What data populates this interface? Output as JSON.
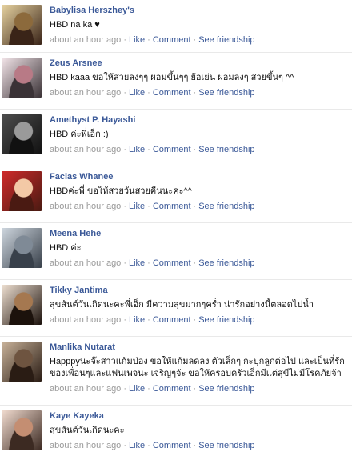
{
  "posts": [
    {
      "name": "Babylisa Herszhey's",
      "text": "HBD na ka ♥",
      "colors": [
        "#e7d3a0",
        "#8c6a3c",
        "#3a2418"
      ]
    },
    {
      "name": "Zeus Arsnee",
      "text": "HBD kaaa ขอให้สวยลงๆๆ ผอมขึ้นๆๆ ย้อเย่น ผอมลงๆ สวยขึ้นๆ ^^",
      "colors": [
        "#f4e6ea",
        "#b87a86",
        "#3a3236"
      ]
    },
    {
      "name": "Amethyst P. Hayashi",
      "text": "HBD ค่ะพี่เอ็ก :)",
      "colors": [
        "#4d4d4d",
        "#9a9a9a",
        "#111111"
      ]
    },
    {
      "name": "Facias Whanee",
      "text": "HBDค่ะพี่ ขอให้สวยวันสวยคืนนะคะ^^",
      "colors": [
        "#d02b2b",
        "#f3c9a6",
        "#4a1a12"
      ]
    },
    {
      "name": "Meena Hehe",
      "text": "HBD ค่ะ",
      "colors": [
        "#cfd7df",
        "#7f8a96",
        "#38404a"
      ]
    },
    {
      "name": "Tikky Jantima",
      "text": "สุขสันต์วันเกิดนะคะพี่เอ็ก มีความสุขมากๆคร่ำ น่ารักอย่างนี้ตลอดไปน้ำ",
      "colors": [
        "#efe0d2",
        "#a57850",
        "#1c120c"
      ]
    },
    {
      "name": "Manlika Nutarat",
      "text": "Happpyนะจ๊ะสาวแก้มป่อง ขอให้แก้มลดลง ตัวเล็กๆ กะปุกลูกต่อไป และเป็นที่รักของเพื่อนๆและแฟนเพจนะ เจริญๆจ้ะ ขอให้ครอบครัวเอ็กมีแต่สุขีไม่มีโรคภัยจ้า",
      "colors": [
        "#c9b39a",
        "#6e5440",
        "#2a1c14"
      ]
    },
    {
      "name": "Kaye Kayeka",
      "text": "สุขสันต์วันเกิดนะคะ",
      "colors": [
        "#f2dcd0",
        "#c48e72",
        "#3c2a22"
      ]
    }
  ],
  "meta": {
    "time": "about an hour ago",
    "sep": "·",
    "like": "Like",
    "comment": "Comment",
    "friendship": "See friendship"
  }
}
